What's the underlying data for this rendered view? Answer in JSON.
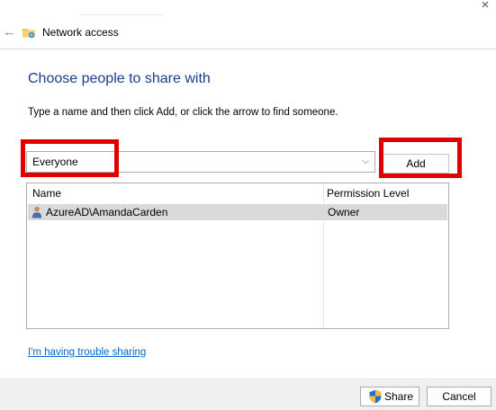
{
  "window": {
    "title": "Network access",
    "close_glyph": "×",
    "back_glyph": "←"
  },
  "main": {
    "heading": "Choose people to share with",
    "instruction": "Type a name and then click Add, or click the arrow to find someone.",
    "name_input": {
      "value": "Everyone",
      "dropdown_glyph": "⌵"
    },
    "add_label": "Add"
  },
  "list": {
    "columns": [
      "Name",
      "Permission Level"
    ],
    "rows": [
      {
        "name": "AzureAD\\AmandaCarden",
        "permission": "Owner",
        "icon": "user-icon",
        "selected": true
      }
    ]
  },
  "trouble_link": "I'm having trouble sharing",
  "footer": {
    "share_label": "Share",
    "cancel_label": "Cancel",
    "share_icon": "uac-shield-icon"
  },
  "colors": {
    "heading": "#1a3d8a",
    "link": "#0066cc",
    "highlight": "#e00000",
    "selected_row": "#dadada",
    "footer_bg": "#f0f0f0"
  }
}
